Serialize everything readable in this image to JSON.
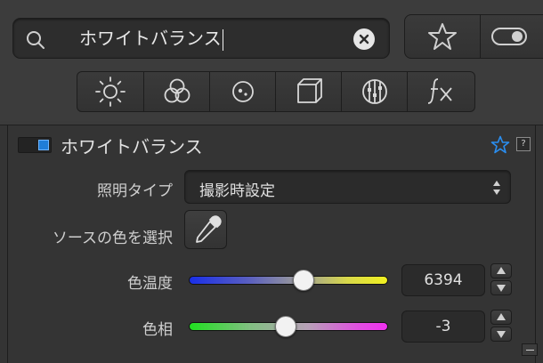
{
  "search": {
    "value": "ホワイトバランス"
  },
  "section": {
    "title": "ホワイトバランス"
  },
  "lighting": {
    "label": "照明タイプ",
    "selected": "撮影時設定"
  },
  "source_color": {
    "label": "ソースの色を選択"
  },
  "temperature": {
    "label": "色温度",
    "value": "6394"
  },
  "tint": {
    "label": "色相",
    "value": "-3"
  },
  "help": {
    "label": "?"
  },
  "icons": {
    "search": "search-icon",
    "clear": "clear-search-icon",
    "favorites": "star-icon",
    "toggle": "toggle-switch-icon",
    "tools": [
      "light-icon",
      "color-icon",
      "detail-icon",
      "geometry-icon",
      "local-adjustments-icon",
      "effects-icon"
    ]
  },
  "colors": {
    "accent": "#1f7dd8",
    "background": "#3b3b3b"
  }
}
